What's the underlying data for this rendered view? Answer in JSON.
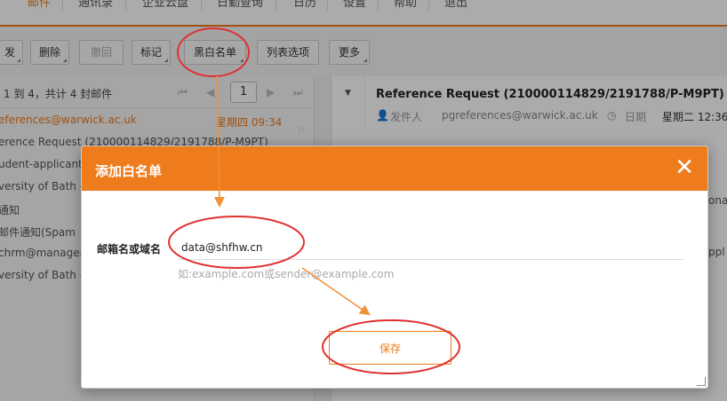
{
  "nav": {
    "items": [
      "邮件",
      "通讯录",
      "企业云盘",
      "日勤查询",
      "日历",
      "设置",
      "帮助",
      "退出"
    ],
    "active_index": 0
  },
  "toolbar": {
    "buttons": [
      "发",
      "删除",
      "撤回",
      "标记",
      "黑白名单",
      "列表选项",
      "更多"
    ],
    "disabled_index": 2
  },
  "list": {
    "pager_text": "1 到 4，共计 4 封邮件",
    "page_number": "1",
    "rows": [
      "eferences@warwick.ac.uk",
      "erence Request (210000114829/2191788/P-M9PT)",
      "udent-applicant",
      "versity of Bath -",
      "通知",
      "邮件通知(Spam",
      "chrm@managen",
      "versity of Bath -"
    ],
    "date": "星期四 09:34"
  },
  "reader": {
    "subject": "Reference Request (210000114829/2191788/P-M9PT)",
    "sender_label": "发件人",
    "sender_value": "pgreferences@warwick.ac.uk",
    "date_label": "日期",
    "date_value": "星期二 12:36",
    "fragments": [
      "onal",
      "ppl"
    ]
  },
  "dialog": {
    "title": "添加白名单",
    "close_glyph": "✕",
    "field_label": "邮箱名或域名",
    "field_value": "data@shfhw.cn",
    "hint": "如:example.com或sender@example.com",
    "save_label": "保存"
  },
  "colors": {
    "accent": "#ee7b1c",
    "annotation_red": "#e03030",
    "annotation_arrow": "#f0913a"
  },
  "icons": {
    "close": "close-icon",
    "user": "user-icon",
    "clock": "clock-icon",
    "flag": "flag-icon",
    "resize": "resize-handle-icon"
  }
}
